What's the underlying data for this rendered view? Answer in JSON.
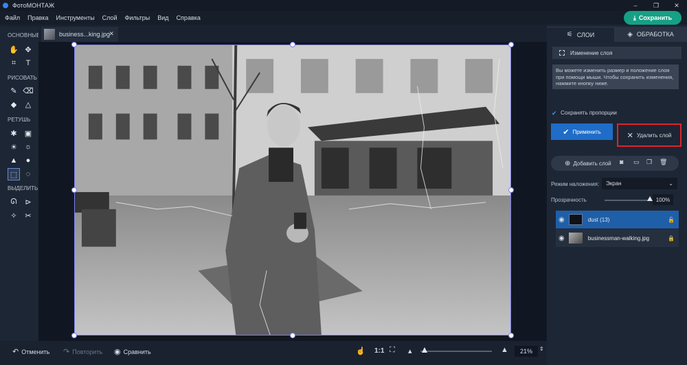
{
  "app": {
    "title": "ФотоМОНТАЖ"
  },
  "window_controls": [
    "–",
    "❐",
    "✕"
  ],
  "menu": [
    "Файл",
    "Правка",
    "Инструменты",
    "Слой",
    "Фильтры",
    "Вид",
    "Справка"
  ],
  "save_button": {
    "label": "Сохранить",
    "icon": "download-icon"
  },
  "toolbar": {
    "sections": [
      "ОСНОВНЫЕ",
      "РИСОВАТЬ",
      "РЕТУШЬ",
      "ВЫДЕЛИТЬ"
    ],
    "tools": [
      {
        "name": "hand-tool-icon",
        "glyph": "✋"
      },
      {
        "name": "move-tool-icon",
        "glyph": "✥"
      },
      {
        "name": "crop-tool-icon",
        "glyph": "⌗"
      },
      {
        "name": "text-tool-icon",
        "glyph": "T"
      },
      {
        "name": "brush-tool-icon",
        "glyph": "✎"
      },
      {
        "name": "eraser-tool-icon",
        "glyph": "⌫"
      },
      {
        "name": "fill-tool-icon",
        "glyph": "◆"
      },
      {
        "name": "shapes-tool-icon",
        "glyph": "△"
      },
      {
        "name": "heal-tool-icon",
        "glyph": "✱"
      },
      {
        "name": "stamp-tool-icon",
        "glyph": "▣"
      },
      {
        "name": "dodge-tool-icon",
        "glyph": "☀"
      },
      {
        "name": "burn-tool-icon",
        "glyph": "☼"
      },
      {
        "name": "sharpen-tool-icon",
        "glyph": "▲"
      },
      {
        "name": "blur-tool-icon",
        "glyph": "●"
      },
      {
        "name": "rect-select-tool-icon",
        "glyph": "⬚"
      },
      {
        "name": "ellipse-select-tool-icon",
        "glyph": "◌"
      },
      {
        "name": "lasso-tool-icon",
        "glyph": "ᘏ"
      },
      {
        "name": "polygon-lasso-tool-icon",
        "glyph": "⊳"
      },
      {
        "name": "magic-wand-tool-icon",
        "glyph": "✧"
      },
      {
        "name": "quick-select-tool-icon",
        "glyph": "✂"
      }
    ]
  },
  "document_tab": {
    "name": "business...king.jpg",
    "close": "✕"
  },
  "bottom_bar": {
    "undo": "Отменить",
    "redo": "Повторить",
    "compare": "Сравнить",
    "one_to_one": "1:1",
    "zoom": "21%"
  },
  "right_panel": {
    "tabs": [
      {
        "label": "СЛОИ",
        "icon": "sliders-icon"
      },
      {
        "label": "ОБРАБОТКА",
        "icon": "layers-icon"
      }
    ],
    "layer_edit": "Изменение слоя",
    "hint": "Вы можете изменить размер и положение слоя при помощи мыши. Чтобы сохранить изменения, нажмите кнопку ниже.",
    "keep_proportions": "Сохранять пропорции",
    "apply": "Применить",
    "delete_layer": "Удалить слой",
    "add_layer": "Добавить слой",
    "blend_mode_label": "Режим наложения:",
    "blend_mode_value": "Экран",
    "opacity_label": "Прозрачность",
    "opacity_value": "100%",
    "opacity_fraction": 1.0,
    "layers": [
      {
        "name": "dust (13)",
        "selected": true
      },
      {
        "name": "businessman-walking.jpg",
        "selected": false
      }
    ]
  },
  "zoom_fraction": 0.06
}
